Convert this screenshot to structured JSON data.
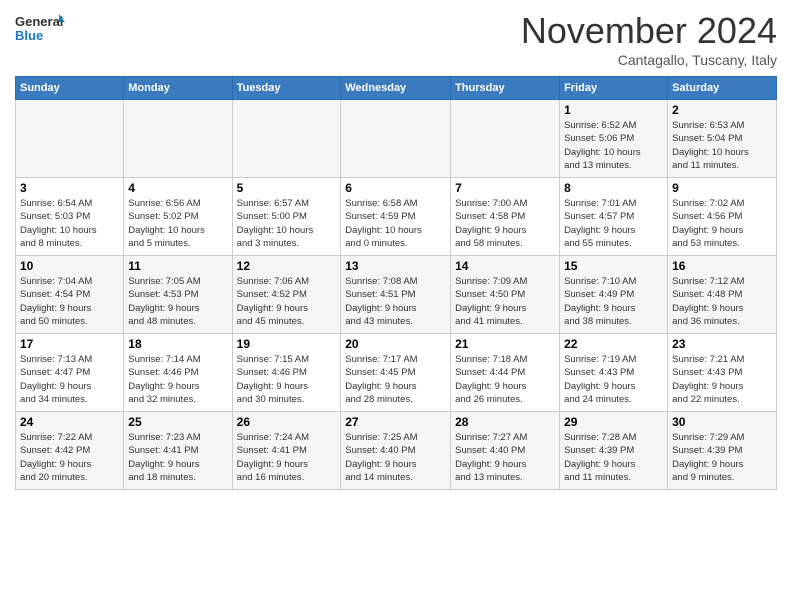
{
  "header": {
    "logo_line1": "General",
    "logo_line2": "Blue",
    "month": "November 2024",
    "location": "Cantagallo, Tuscany, Italy"
  },
  "weekdays": [
    "Sunday",
    "Monday",
    "Tuesday",
    "Wednesday",
    "Thursday",
    "Friday",
    "Saturday"
  ],
  "weeks": [
    [
      {
        "day": "",
        "info": ""
      },
      {
        "day": "",
        "info": ""
      },
      {
        "day": "",
        "info": ""
      },
      {
        "day": "",
        "info": ""
      },
      {
        "day": "",
        "info": ""
      },
      {
        "day": "1",
        "info": "Sunrise: 6:52 AM\nSunset: 5:06 PM\nDaylight: 10 hours\nand 13 minutes."
      },
      {
        "day": "2",
        "info": "Sunrise: 6:53 AM\nSunset: 5:04 PM\nDaylight: 10 hours\nand 11 minutes."
      }
    ],
    [
      {
        "day": "3",
        "info": "Sunrise: 6:54 AM\nSunset: 5:03 PM\nDaylight: 10 hours\nand 8 minutes."
      },
      {
        "day": "4",
        "info": "Sunrise: 6:56 AM\nSunset: 5:02 PM\nDaylight: 10 hours\nand 5 minutes."
      },
      {
        "day": "5",
        "info": "Sunrise: 6:57 AM\nSunset: 5:00 PM\nDaylight: 10 hours\nand 3 minutes."
      },
      {
        "day": "6",
        "info": "Sunrise: 6:58 AM\nSunset: 4:59 PM\nDaylight: 10 hours\nand 0 minutes."
      },
      {
        "day": "7",
        "info": "Sunrise: 7:00 AM\nSunset: 4:58 PM\nDaylight: 9 hours\nand 58 minutes."
      },
      {
        "day": "8",
        "info": "Sunrise: 7:01 AM\nSunset: 4:57 PM\nDaylight: 9 hours\nand 55 minutes."
      },
      {
        "day": "9",
        "info": "Sunrise: 7:02 AM\nSunset: 4:56 PM\nDaylight: 9 hours\nand 53 minutes."
      }
    ],
    [
      {
        "day": "10",
        "info": "Sunrise: 7:04 AM\nSunset: 4:54 PM\nDaylight: 9 hours\nand 50 minutes."
      },
      {
        "day": "11",
        "info": "Sunrise: 7:05 AM\nSunset: 4:53 PM\nDaylight: 9 hours\nand 48 minutes."
      },
      {
        "day": "12",
        "info": "Sunrise: 7:06 AM\nSunset: 4:52 PM\nDaylight: 9 hours\nand 45 minutes."
      },
      {
        "day": "13",
        "info": "Sunrise: 7:08 AM\nSunset: 4:51 PM\nDaylight: 9 hours\nand 43 minutes."
      },
      {
        "day": "14",
        "info": "Sunrise: 7:09 AM\nSunset: 4:50 PM\nDaylight: 9 hours\nand 41 minutes."
      },
      {
        "day": "15",
        "info": "Sunrise: 7:10 AM\nSunset: 4:49 PM\nDaylight: 9 hours\nand 38 minutes."
      },
      {
        "day": "16",
        "info": "Sunrise: 7:12 AM\nSunset: 4:48 PM\nDaylight: 9 hours\nand 36 minutes."
      }
    ],
    [
      {
        "day": "17",
        "info": "Sunrise: 7:13 AM\nSunset: 4:47 PM\nDaylight: 9 hours\nand 34 minutes."
      },
      {
        "day": "18",
        "info": "Sunrise: 7:14 AM\nSunset: 4:46 PM\nDaylight: 9 hours\nand 32 minutes."
      },
      {
        "day": "19",
        "info": "Sunrise: 7:15 AM\nSunset: 4:46 PM\nDaylight: 9 hours\nand 30 minutes."
      },
      {
        "day": "20",
        "info": "Sunrise: 7:17 AM\nSunset: 4:45 PM\nDaylight: 9 hours\nand 28 minutes."
      },
      {
        "day": "21",
        "info": "Sunrise: 7:18 AM\nSunset: 4:44 PM\nDaylight: 9 hours\nand 26 minutes."
      },
      {
        "day": "22",
        "info": "Sunrise: 7:19 AM\nSunset: 4:43 PM\nDaylight: 9 hours\nand 24 minutes."
      },
      {
        "day": "23",
        "info": "Sunrise: 7:21 AM\nSunset: 4:43 PM\nDaylight: 9 hours\nand 22 minutes."
      }
    ],
    [
      {
        "day": "24",
        "info": "Sunrise: 7:22 AM\nSunset: 4:42 PM\nDaylight: 9 hours\nand 20 minutes."
      },
      {
        "day": "25",
        "info": "Sunrise: 7:23 AM\nSunset: 4:41 PM\nDaylight: 9 hours\nand 18 minutes."
      },
      {
        "day": "26",
        "info": "Sunrise: 7:24 AM\nSunset: 4:41 PM\nDaylight: 9 hours\nand 16 minutes."
      },
      {
        "day": "27",
        "info": "Sunrise: 7:25 AM\nSunset: 4:40 PM\nDaylight: 9 hours\nand 14 minutes."
      },
      {
        "day": "28",
        "info": "Sunrise: 7:27 AM\nSunset: 4:40 PM\nDaylight: 9 hours\nand 13 minutes."
      },
      {
        "day": "29",
        "info": "Sunrise: 7:28 AM\nSunset: 4:39 PM\nDaylight: 9 hours\nand 11 minutes."
      },
      {
        "day": "30",
        "info": "Sunrise: 7:29 AM\nSunset: 4:39 PM\nDaylight: 9 hours\nand 9 minutes."
      }
    ]
  ]
}
